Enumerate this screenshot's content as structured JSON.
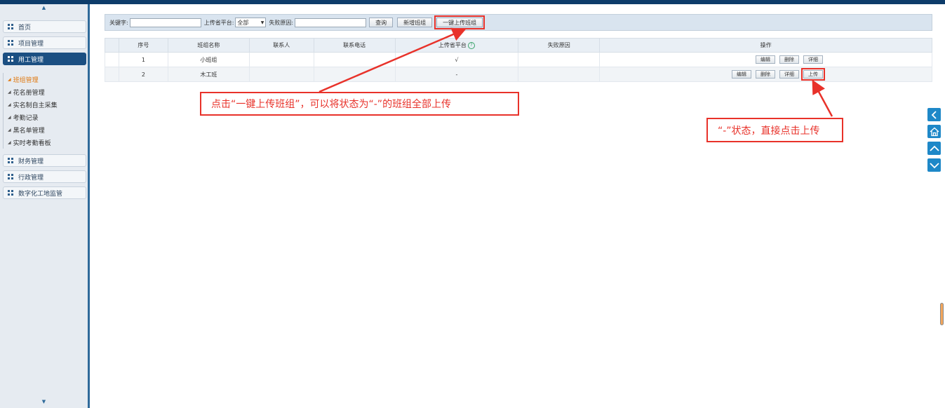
{
  "sidebar": {
    "items": [
      {
        "label": "首页"
      },
      {
        "label": "项目管理"
      },
      {
        "label": "用工管理",
        "active": true
      },
      {
        "label": "财务管理"
      },
      {
        "label": "行政管理"
      },
      {
        "label": "数字化工地监管"
      }
    ],
    "subitems": [
      {
        "label": "班组管理",
        "active": true
      },
      {
        "label": "花名册管理"
      },
      {
        "label": "实名制自主采集"
      },
      {
        "label": "考勤记录"
      },
      {
        "label": "黑名单管理"
      },
      {
        "label": "实时考勤看板"
      }
    ]
  },
  "toolbar": {
    "keyword_label": "关键字:",
    "platform_label": "上传省平台:",
    "platform_selected": "全部",
    "reason_label": "失败原因:",
    "query_btn": "查询",
    "add_btn": "新增班组",
    "upload_all_btn": "一键上传班组"
  },
  "table": {
    "headers": [
      "序号",
      "班组名称",
      "联系人",
      "联系电话",
      "上传省平台",
      "失败原因",
      "操作"
    ],
    "rows": [
      {
        "index": "1",
        "name": "小班组",
        "contact": "",
        "phone": "",
        "status": "√",
        "reason": ""
      },
      {
        "index": "2",
        "name": "木工班",
        "contact": "",
        "phone": "",
        "status": "-",
        "reason": ""
      }
    ],
    "actions": {
      "edit": "编辑",
      "delete": "删除",
      "detail": "详细",
      "upload": "上传"
    }
  },
  "callouts": {
    "main": "点击“一键上传班组”，可以将状态为“-”的班组全部上传",
    "secondary": "“-”状态，直接点击上传"
  },
  "colors": {
    "accent": "#e8322a",
    "sidebar_active": "#1b4f82",
    "nav_blue": "#1e88c8"
  }
}
